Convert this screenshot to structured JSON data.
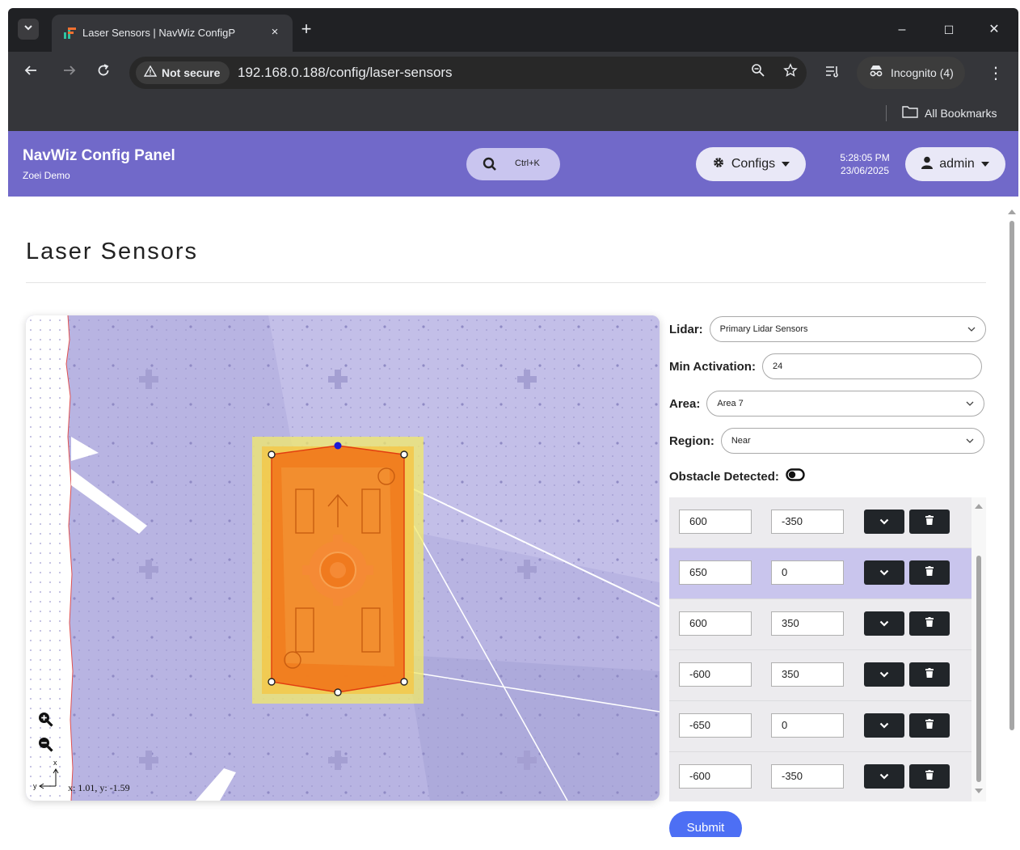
{
  "browser": {
    "tab_title": "Laser Sensors | NavWiz ConfigP",
    "tab_close": "×",
    "new_tab": "+",
    "not_secure": "Not secure",
    "url": "192.168.0.188/config/laser-sensors",
    "incognito": "Incognito (4)",
    "bookmarks_all": "All Bookmarks",
    "window_minimize": "–",
    "window_maximize": "☐",
    "window_close": "✕"
  },
  "app": {
    "title": "NavWiz Config Panel",
    "subtitle": "Zoei Demo",
    "search_shortcut": "Ctrl+K",
    "configs_label": "Configs",
    "time": "5:28:05 PM",
    "date": "23/06/2025",
    "user_label": "admin",
    "accent_color": "#7169c9"
  },
  "page": {
    "title": "Laser Sensors"
  },
  "map": {
    "coordinate_readout": "x: 1.01, y: -1.59",
    "axis_x": "x",
    "axis_y": "y"
  },
  "form": {
    "lidar_label": "Lidar:",
    "lidar_value": "Primary Lidar Sensors",
    "min_activation_label": "Min Activation:",
    "min_activation_value": "24",
    "area_label": "Area:",
    "area_value": "Area 7",
    "region_label": "Region:",
    "region_value": "Near",
    "obstacle_label": "Obstacle Detected:",
    "submit_label": "Submit"
  },
  "points": [
    {
      "x": "600",
      "y": "-350"
    },
    {
      "x": "650",
      "y": "0"
    },
    {
      "x": "600",
      "y": "350"
    },
    {
      "x": "-600",
      "y": "350"
    },
    {
      "x": "-650",
      "y": "0"
    },
    {
      "x": "-600",
      "y": "-350"
    }
  ]
}
